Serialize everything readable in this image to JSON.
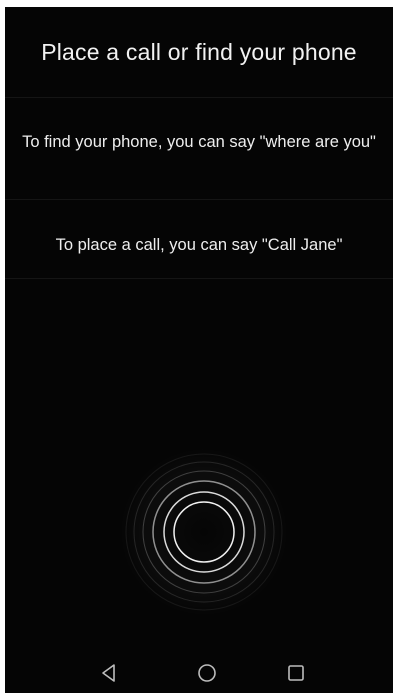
{
  "header": {
    "title": "Place a call or find your phone"
  },
  "hints": {
    "find_phone": "To find your phone, you can say \"where are you\"",
    "place_call": "To place a call, you can say \"Call Jane\""
  },
  "icons": {
    "voice": "microphone-pulse-icon",
    "back": "back-triangle-icon",
    "home": "home-circle-icon",
    "recents": "recents-square-icon"
  },
  "colors": {
    "background": "#050505",
    "text": "#f2f2f2",
    "ring": "#ffffff"
  }
}
